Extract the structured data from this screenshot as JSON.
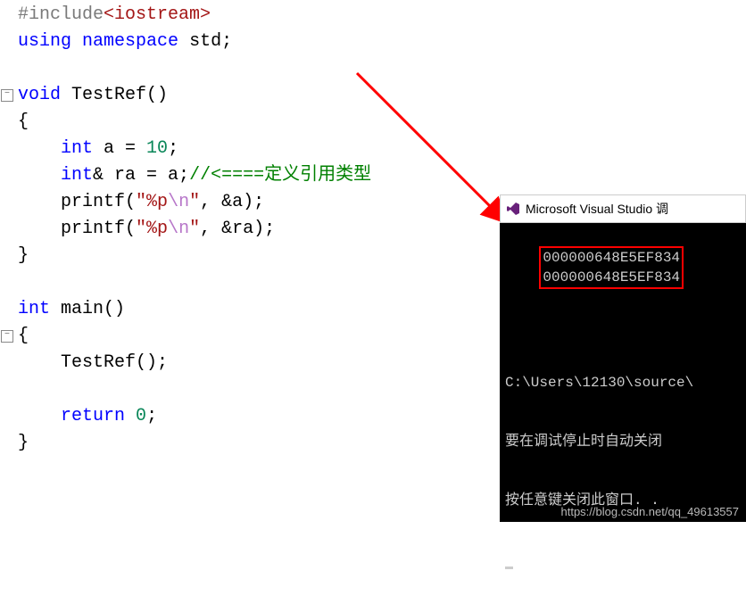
{
  "code": {
    "line1_pre": "#include",
    "line1_inc": "<iostream>",
    "line2_using": "using",
    "line2_ns": "namespace",
    "line2_std": " std;",
    "line4_void": "void",
    "line4_rest": " TestRef()",
    "line5": "{",
    "line6_type": "int",
    "line6_rest": " a = ",
    "line6_num": "10",
    "line6_semi": ";",
    "line7_type": "int",
    "line7_rest": "& ra = a;",
    "line7_comment": "//<====定义引用类型",
    "line8_fn": "    printf(",
    "line8_q1": "\"",
    "line8_fmt": "%p",
    "line8_esc": "\\n",
    "line8_q2": "\"",
    "line8_rest": ", &a);",
    "line9_fn": "    printf(",
    "line9_q1": "\"",
    "line9_fmt": "%p",
    "line9_esc": "\\n",
    "line9_q2": "\"",
    "line9_rest": ", &ra);",
    "line10": "}",
    "line12_int": "int",
    "line12_rest": " main()",
    "line13": "{",
    "line14": "    TestRef();",
    "line16_ret": "return",
    "line16_num": "0",
    "line16_rest": ";",
    "line17": "}"
  },
  "console": {
    "title": "Microsoft Visual Studio 调",
    "addr1": "000000648E5EF834",
    "addr2": "000000648E5EF834",
    "path": "C:\\Users\\12130\\source\\",
    "msg1": "要在调试停止时自动关闭",
    "msg2": "按任意键关闭此窗口. ."
  },
  "watermark": "https://blog.csdn.net/qq_49613557",
  "fold_glyph": "−"
}
